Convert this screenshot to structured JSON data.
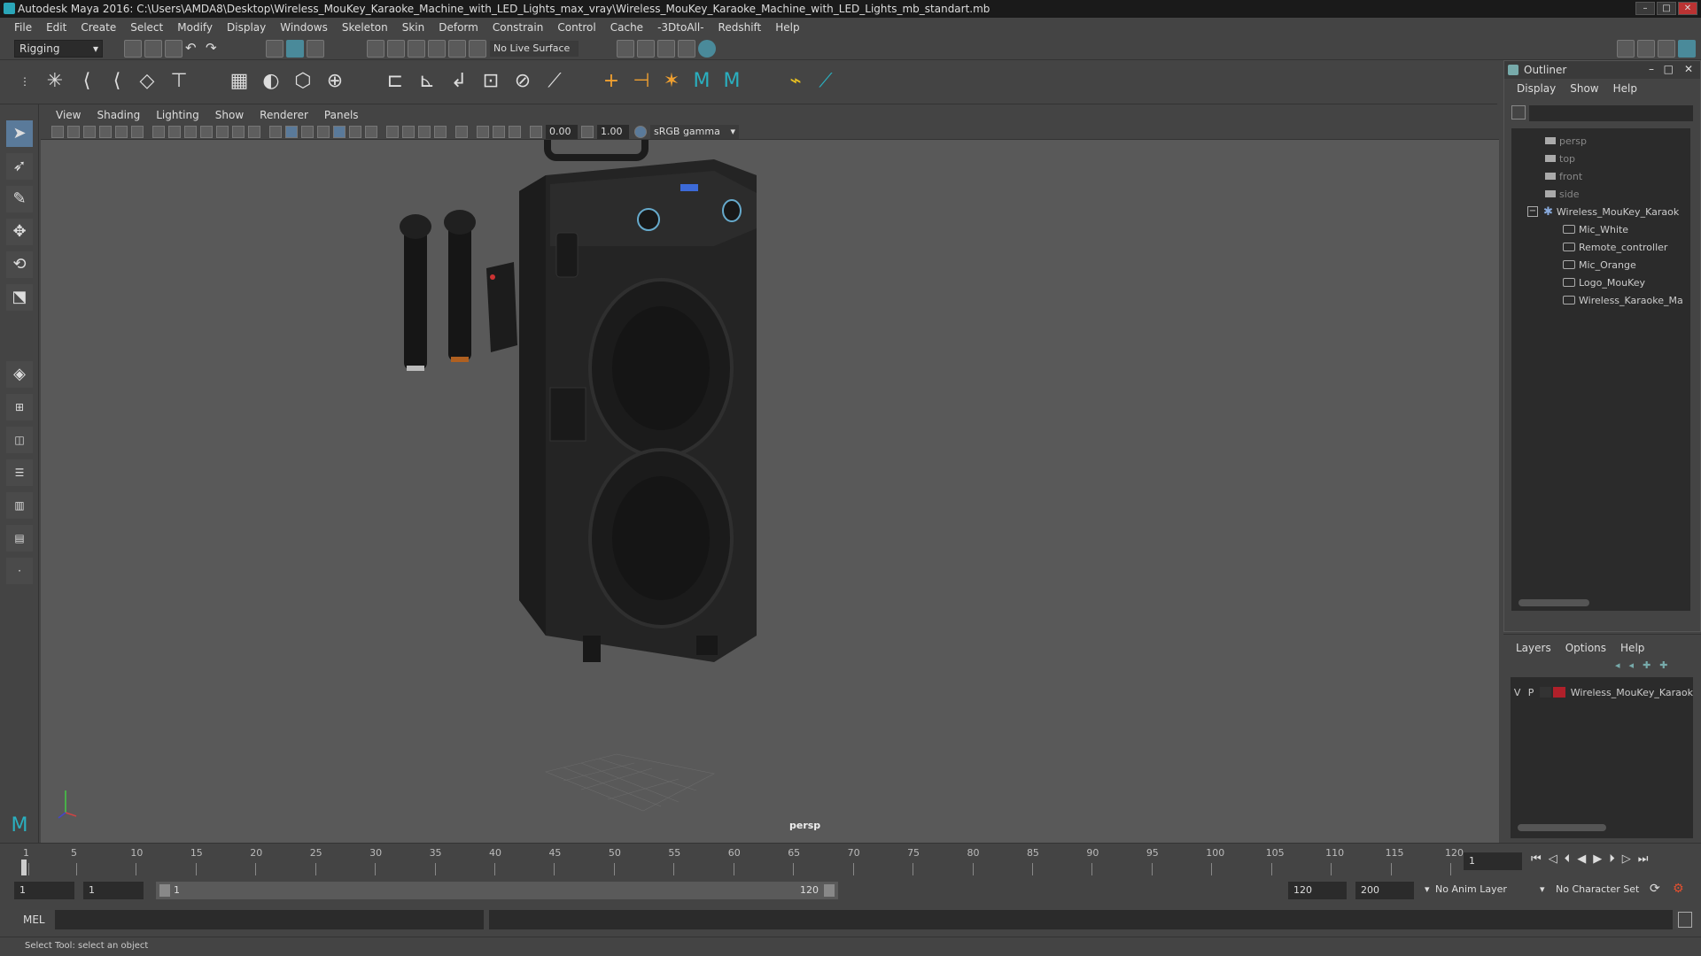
{
  "window": {
    "title": "Autodesk Maya 2016: C:\\Users\\AMDA8\\Desktop\\Wireless_MouKey_Karaoke_Machine_with_LED_Lights_max_vray\\Wireless_MouKey_Karaoke_Machine_with_LED_Lights_mb_standart.mb"
  },
  "menubar": [
    "File",
    "Edit",
    "Create",
    "Select",
    "Modify",
    "Display",
    "Windows",
    "Skeleton",
    "Skin",
    "Deform",
    "Constrain",
    "Control",
    "Cache",
    "-3DtoAll-",
    "Redshift",
    "Help"
  ],
  "statusline": {
    "mode": "Rigging",
    "live_surface": "No Live Surface"
  },
  "viewport": {
    "menu": [
      "View",
      "Shading",
      "Lighting",
      "Show",
      "Renderer",
      "Panels"
    ],
    "exposure": "0.00",
    "gamma": "1.00",
    "color_space": "sRGB gamma",
    "camera_label": "persp"
  },
  "outliner": {
    "title": "Outliner",
    "menu": [
      "Display",
      "Show",
      "Help"
    ],
    "items": [
      {
        "label": "persp",
        "type": "camera"
      },
      {
        "label": "top",
        "type": "camera"
      },
      {
        "label": "front",
        "type": "camera"
      },
      {
        "label": "side",
        "type": "camera"
      },
      {
        "label": "Wireless_MouKey_Karaok",
        "type": "group"
      },
      {
        "label": "Mic_White",
        "type": "mesh"
      },
      {
        "label": "Remote_controller",
        "type": "mesh"
      },
      {
        "label": "Mic_Orange",
        "type": "mesh"
      },
      {
        "label": "Logo_MouKey",
        "type": "mesh"
      },
      {
        "label": "Wireless_Karaoke_Ma",
        "type": "mesh"
      }
    ]
  },
  "layers": {
    "menu": [
      "Layers",
      "Options",
      "Help"
    ],
    "layer": {
      "v": "V",
      "p": "P",
      "name": "Wireless_MouKey_Karaok",
      "color": "#b0202a"
    }
  },
  "timeline": {
    "ticks": [
      "1",
      "5",
      "10",
      "15",
      "20",
      "25",
      "30",
      "35",
      "40",
      "45",
      "50",
      "55",
      "60",
      "65",
      "70",
      "75",
      "80",
      "85",
      "90",
      "95",
      "100",
      "105",
      "110",
      "115",
      "120"
    ],
    "current_frame": "1"
  },
  "range": {
    "start": "1",
    "playback_start": "1",
    "range_start_label": "1",
    "range_end_label": "120",
    "playback_end": "120",
    "end": "200",
    "anim_layer": "No Anim Layer",
    "character_set": "No Character Set"
  },
  "cmdline": {
    "label": "MEL"
  },
  "helpline": {
    "text": "Select Tool: select an object"
  }
}
